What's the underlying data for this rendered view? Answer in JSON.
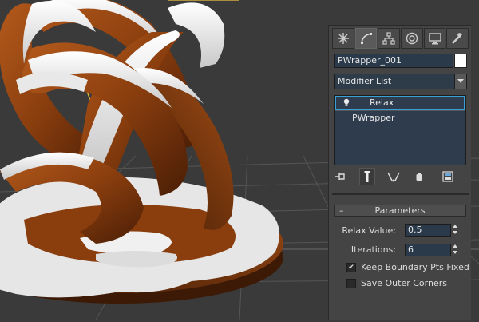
{
  "command_panel": {
    "tabs": [
      {
        "icon": "create-icon"
      },
      {
        "icon": "modify-icon",
        "active": true
      },
      {
        "icon": "hierarchy-icon"
      },
      {
        "icon": "motion-icon"
      },
      {
        "icon": "display-icon"
      },
      {
        "icon": "utilities-icon"
      }
    ],
    "object_name": "PWrapper_001",
    "object_color": "#ffffff",
    "modifier_list_label": "Modifier List",
    "stack": [
      {
        "label": "Relax",
        "selected": true
      },
      {
        "label": "PWrapper",
        "selected": false
      }
    ]
  },
  "rollout": {
    "title": "Parameters",
    "collapse_symbol": "–",
    "relax_value_label": "Relax Value:",
    "relax_value": "0.5",
    "iterations_label": "Iterations:",
    "iterations": "6",
    "keep_boundary_label": "Keep Boundary Pts Fixed",
    "keep_boundary_checked": true,
    "save_outer_label": "Save Outer Corners",
    "save_outer_checked": false
  },
  "colors": {
    "viewport_bg": "#3a3a3a",
    "grid": "#565656",
    "gingerbread": "#8a3e0e",
    "frosting": "#f2f2f2",
    "selection_blue": "#3aa0d8",
    "camera_yellow": "#f0c040"
  }
}
